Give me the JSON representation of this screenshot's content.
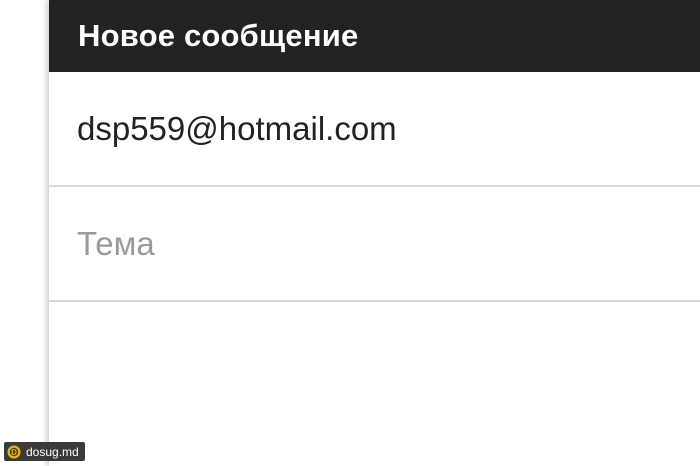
{
  "compose": {
    "title": "Новое сообщение",
    "to_value": "dsp559@hotmail.com",
    "subject_placeholder": "Тема",
    "subject_value": "",
    "body_value": ""
  },
  "watermark": {
    "text": "dosug.md"
  },
  "colors": {
    "header_bg": "#222222",
    "header_text": "#ffffff",
    "divider": "#d9d9d9",
    "placeholder": "#9a9a9a"
  }
}
